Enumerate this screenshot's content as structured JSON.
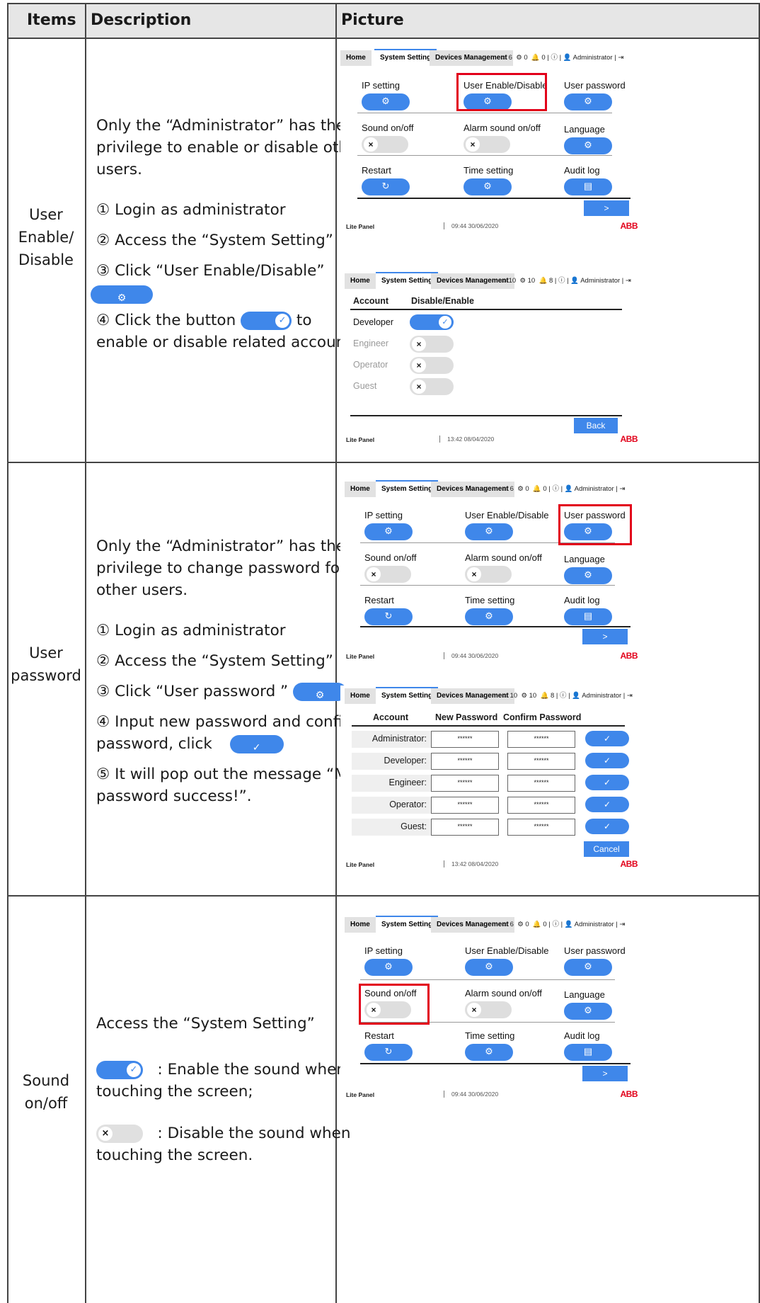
{
  "table": {
    "headers": {
      "items": "Items",
      "description": "Description",
      "picture": "Picture"
    },
    "rows": [
      {
        "item": "User Enable/ Disable",
        "item_lines": [
          "User",
          "Enable/",
          "Disable"
        ],
        "desc_intro": "Only the “Administrator” has the privilege to enable or disable other users.",
        "steps": [
          "① Login as administrator",
          "② Access the “System Setting”",
          "③ Click “User Enable/Disable”",
          "④ Click the button",
          "to",
          "enable or disable related account."
        ]
      },
      {
        "item_lines": [
          "User",
          "password"
        ],
        "desc_intro": "Only the “Administrator” has the privilege to change password for other users.",
        "steps": [
          "① Login as administrator",
          "② Access the “System Setting”",
          "③ Click “User password ”",
          "④ Input new password and confirm password, click",
          "⑤ It will pop out the message “Modify password success!”."
        ]
      },
      {
        "item_lines": [
          "Sound",
          "on/off"
        ],
        "desc_intro": "Access the “System Setting”",
        "on_text": ": Enable the sound when touching the screen;",
        "off_text": ": Disable the sound when touching the screen."
      }
    ]
  },
  "panel": {
    "tabs": [
      "Home",
      "System Setting",
      "Devices Management"
    ],
    "user": "Administrator",
    "settings": [
      "IP setting",
      "User Enable/Disable",
      "User password",
      "Sound on/off",
      "Alarm sound on/off",
      "Language",
      "Restart",
      "Time setting",
      "Audit log"
    ],
    "next": ">",
    "footer_left": "Lite Panel",
    "footer_time1": "09:44 30/06/2020",
    "footer_time2": "13:42 08/04/2020",
    "logo": "ABB",
    "counts_a": [
      "6",
      "0",
      "0"
    ],
    "counts_b": [
      "10",
      "10",
      "8"
    ],
    "enable_header": [
      "Account",
      "Disable/Enable"
    ],
    "accounts": [
      "Developer",
      "Engineer",
      "Operator",
      "Guest"
    ],
    "back": "Back",
    "pw_header": [
      "Account",
      "New Password",
      "Confirm Password"
    ],
    "pw_accounts": [
      "Administrator:",
      "Developer:",
      "Engineer:",
      "Operator:",
      "Guest:"
    ],
    "pw_mask": "******",
    "cancel": "Cancel"
  }
}
